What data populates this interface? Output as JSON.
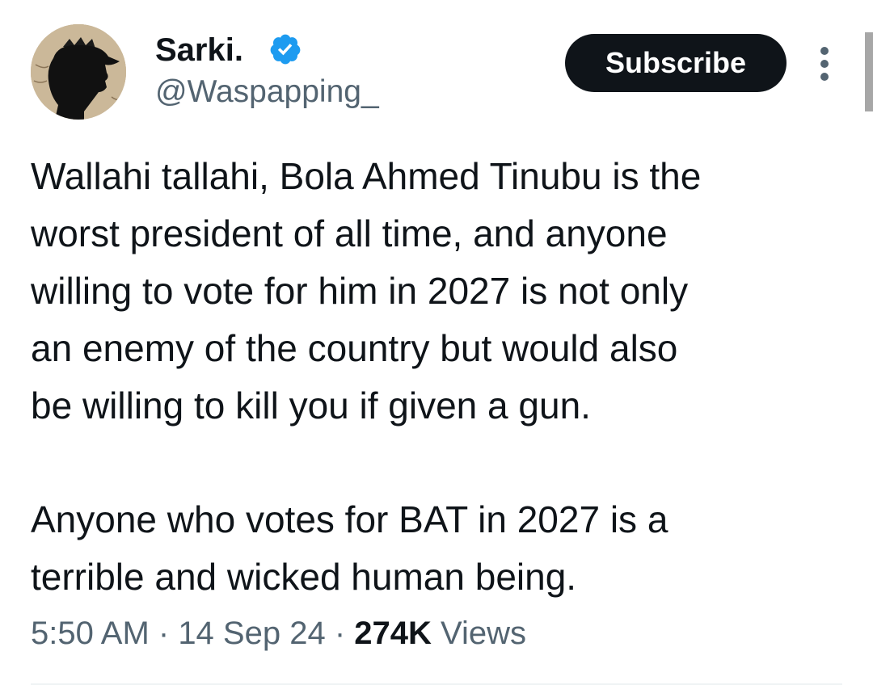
{
  "author": {
    "name": "Sarki.",
    "handle": "@Waspapping_",
    "verified": true,
    "verified_color": "#1d9bf0"
  },
  "actions": {
    "subscribe_label": "Subscribe",
    "more_icon": "more-vertical-icon"
  },
  "tweet": {
    "paragraphs": [
      {
        "lines": [
          "Wallahi tallahi, Bola Ahmed Tinubu is the",
          "worst president of all time, and anyone",
          "willing to vote for him in 2027 is not only",
          "an enemy of the country but would also",
          "be willing to kill you if given a gun."
        ]
      },
      {
        "lines": [
          "Anyone who votes for BAT in 2027 is a",
          "terrible and wicked human being."
        ]
      }
    ]
  },
  "meta": {
    "time": "5:50 AM",
    "separator": " · ",
    "date": "14 Sep 24",
    "views_count": "274K",
    "views_label": " Views"
  },
  "colors": {
    "text_primary": "#0f1419",
    "text_secondary": "#536471",
    "button_bg": "#0f1419",
    "divider": "#eff3f4"
  }
}
